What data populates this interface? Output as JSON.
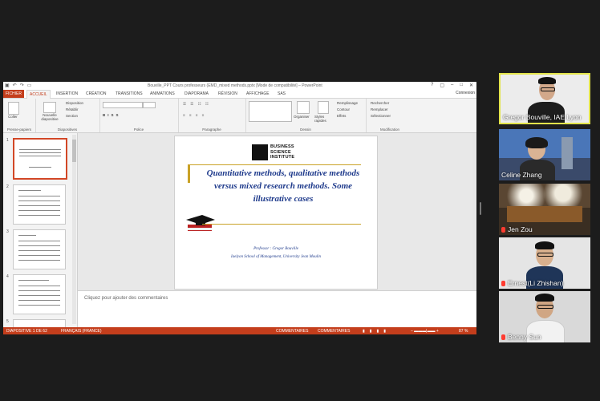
{
  "window": {
    "title": "Bouville_PPT Cours professeurs (EMD_mixed methods.pptx [Mode de compatibilité] – PowerPoint",
    "user": "Connexion"
  },
  "ribbon_tabs": [
    "FICHIER",
    "ACCUEIL",
    "INSERTION",
    "CRÉATION",
    "TRANSITIONS",
    "ANIMATIONS",
    "DIAPORAMA",
    "RÉVISION",
    "AFFICHAGE",
    "SAS"
  ],
  "ribbon_groups": [
    "Presse-papiers",
    "Diapositives",
    "Police",
    "Paragraphe",
    "Dessin",
    "Modification"
  ],
  "ribbon_items": {
    "paste": "Coller",
    "new_slide": "Nouvelle diapositive",
    "layout": "Disposition",
    "reset": "Rétablir",
    "section": "Section",
    "arrange": "Organiser",
    "quick_styles": "Styles rapides",
    "fill": "Remplissage",
    "outline": "Contour",
    "effects": "Effets",
    "find": "Rechercher",
    "replace": "Remplacer",
    "select": "Sélectionner"
  },
  "thumbnails": [
    {
      "num": "1"
    },
    {
      "num": "2"
    },
    {
      "num": "3"
    },
    {
      "num": "4"
    },
    {
      "num": "5"
    }
  ],
  "slide": {
    "logo_lines": [
      "BUSINESS",
      "SCIENCE",
      "INSTITUTE"
    ],
    "title": "Quantitative methods, qualitative methods versus mixed research methods. Some illustrative cases",
    "professor": "Professor : Gregor Bouville",
    "school": "Iaelyon School of Management, University Jean Moulin"
  },
  "notes_placeholder": "Cliquez pour ajouter des commentaires",
  "statusbar": {
    "slide_info": "DIAPOSITIVE 1 DE 62",
    "language": "FRANÇAIS (FRANCE)",
    "notes": "COMMENTAIRES",
    "comments": "COMMENTAIRES",
    "zoom": "87 %"
  },
  "participants": [
    {
      "name": "Gregor Bouville, IAE Lyon",
      "muted": false,
      "active": true
    },
    {
      "name": "Celine Zhang",
      "muted": false,
      "active": false
    },
    {
      "name": "Jen Zou",
      "muted": true,
      "active": false
    },
    {
      "name": "Ernest(Li Zhishan)",
      "muted": true,
      "active": false
    },
    {
      "name": "Benny Sun",
      "muted": true,
      "active": false
    }
  ],
  "colors": {
    "accent": "#c43e1c",
    "slide_title": "#1f3b8c",
    "speaker_border": "#e2e34a"
  }
}
